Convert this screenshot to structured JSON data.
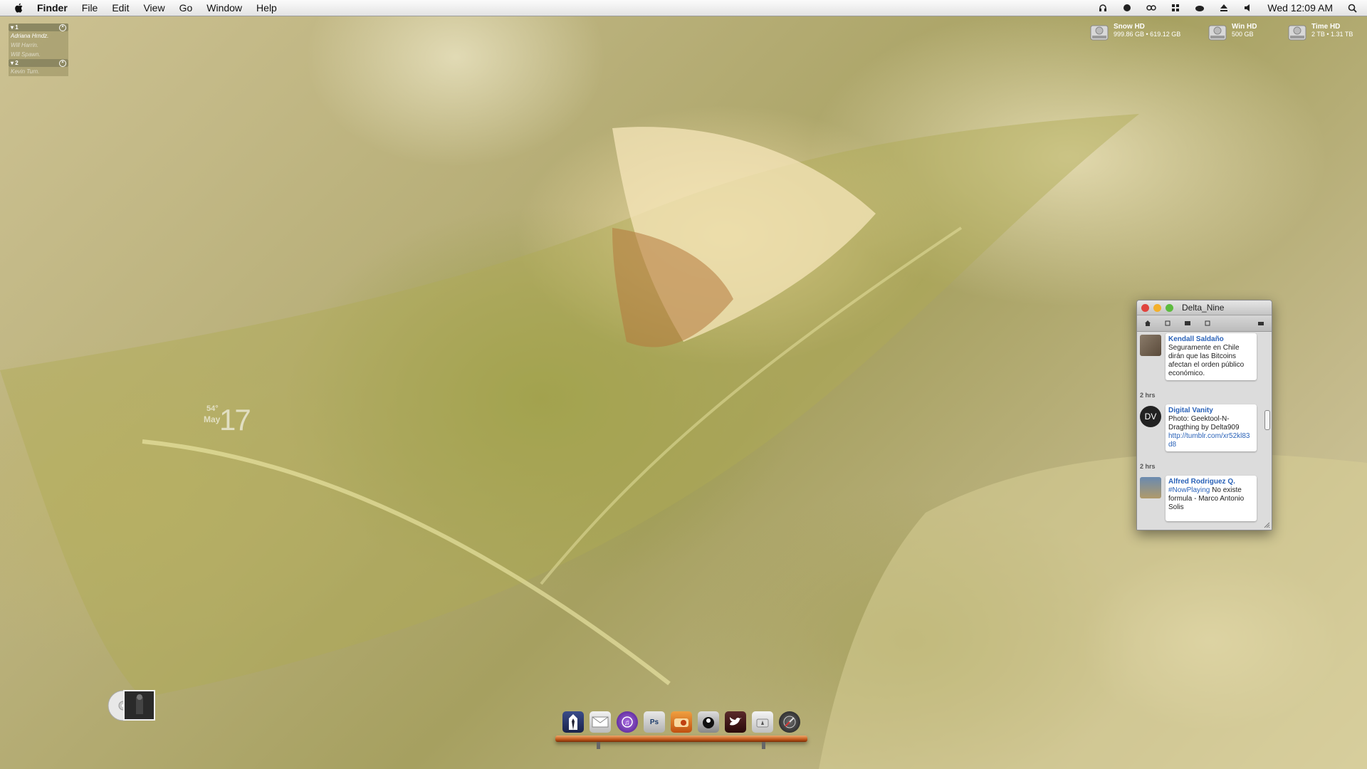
{
  "menubar": {
    "app": "Finder",
    "menus": [
      "File",
      "Edit",
      "View",
      "Go",
      "Window",
      "Help"
    ],
    "clock": "Wed 12:09 AM"
  },
  "contacts": {
    "group1": "▾ 1",
    "group1_names": [
      "Adriana Hrndz.",
      "Will Harrin.",
      "Will Spawn."
    ],
    "group2": "▾ 2",
    "group2_names": [
      "Kevin Turn."
    ]
  },
  "date_widget": {
    "temp": "54°",
    "month": "May",
    "day": "17"
  },
  "drives": [
    {
      "name": "Snow HD",
      "size": "999.86 GB • 619.12 GB"
    },
    {
      "name": "Win HD",
      "size": "500 GB"
    },
    {
      "name": "Time HD",
      "size": "2 TB • 1.31 TB"
    }
  ],
  "twitter": {
    "title": "Delta_Nine",
    "tweets": [
      {
        "author": "Kendall Saldaño",
        "text": "Seguramente en Chile dirán que las Bitcoins afectan el orden público económico."
      },
      {
        "time": "2 hrs",
        "author": "Digital Vanity",
        "avatar_text": "DV",
        "text": "Photo: Geektool-N-Dragthing by Delta909",
        "link": "http://tumblr.com/xr52kl83d8"
      },
      {
        "time": "2 hrs",
        "author": "Alfred Rodriguez Q.",
        "hashtag": "#NowPlaying",
        "text": " No existe formula - Marco Antonio Solis"
      }
    ]
  },
  "dock": {
    "icons": [
      "finder-tux-icon",
      "mail-icon",
      "itunes-icon",
      "photoshop-icon",
      "radio-icon",
      "8ball-icon",
      "twitter-icon",
      "app-store-icon",
      "safari-icon"
    ],
    "ps_label": "Ps"
  },
  "colors": {
    "accent": "#2a62b8",
    "close": "#e0443e",
    "minimize": "#f3b02c",
    "zoom": "#5dbb3f"
  }
}
